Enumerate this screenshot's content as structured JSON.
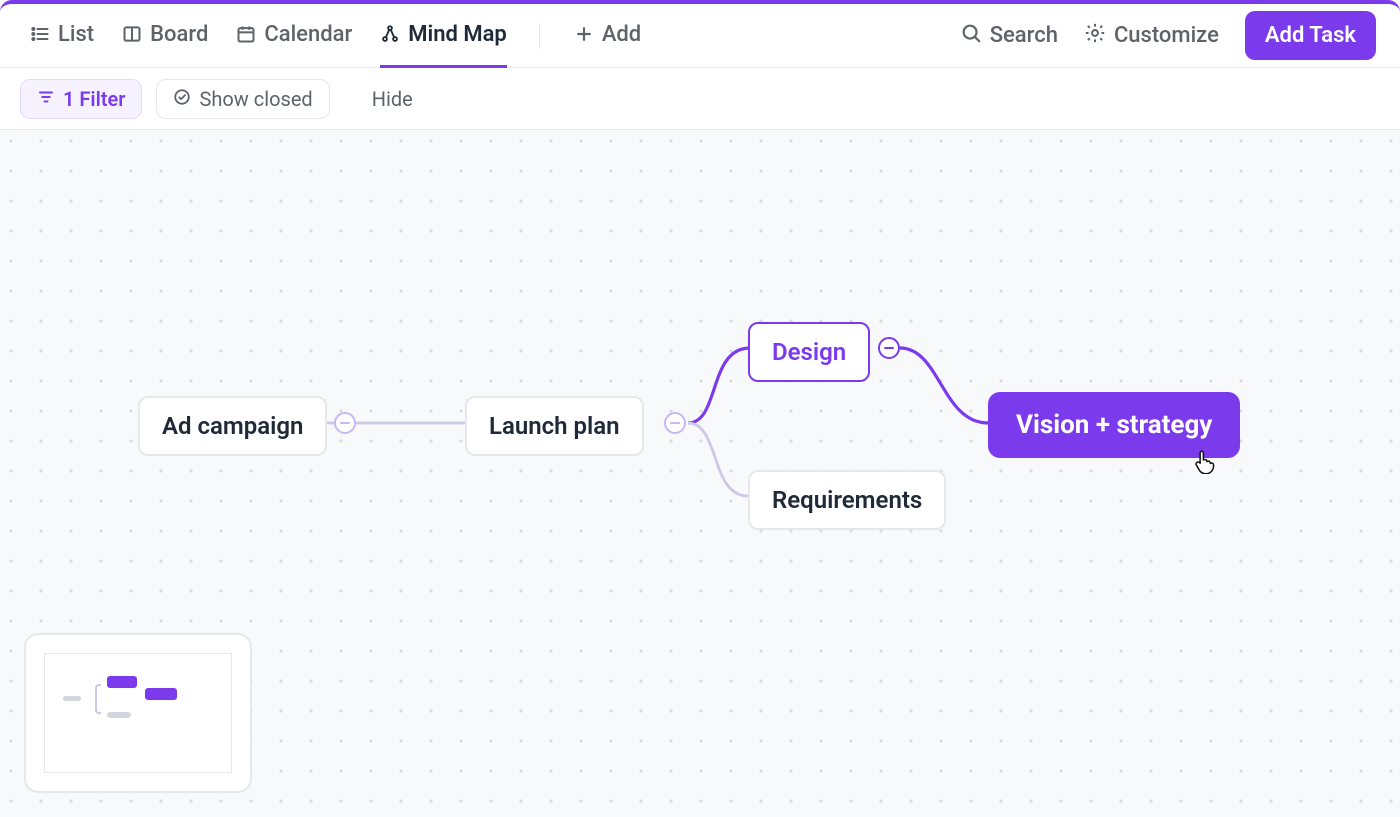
{
  "views": {
    "list": "List",
    "board": "Board",
    "calendar": "Calendar",
    "mindmap": "Mind Map",
    "add": "Add",
    "active": "mindmap"
  },
  "tools": {
    "search": "Search",
    "customize": "Customize",
    "add_task": "Add Task"
  },
  "filters": {
    "filter_label": "1 Filter",
    "show_closed_label": "Show closed",
    "hide_label": "Hide"
  },
  "nodes": {
    "ad_campaign": "Ad campaign",
    "launch_plan": "Launch plan",
    "design": "Design",
    "requirements": "Requirements",
    "vision_strategy": "Vision + strategy"
  }
}
